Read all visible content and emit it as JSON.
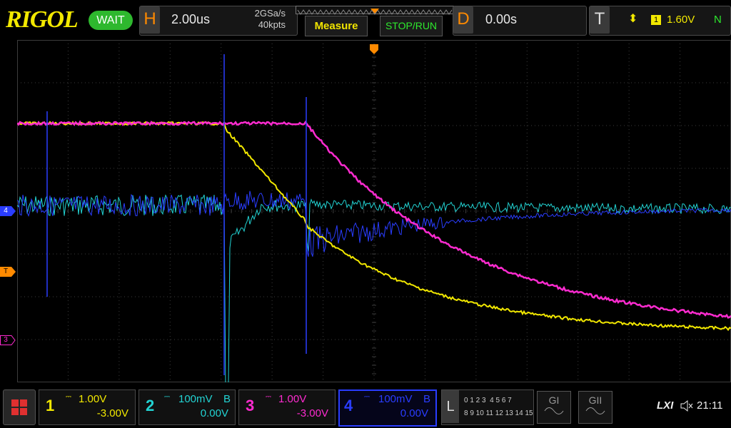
{
  "brand": "RIGOL",
  "run_state": "WAIT",
  "horizontal": {
    "tag": "H",
    "timebase": "2.00us",
    "sample_rate": "2GSa/s",
    "memory_depth": "40kpts"
  },
  "buttons": {
    "measure": "Measure",
    "stop_run": "STOP/RUN"
  },
  "delay": {
    "tag": "D",
    "value": "0.00s"
  },
  "trigger": {
    "tag": "T",
    "slope_symbol": "⬍",
    "source": "1",
    "level": "1.60V",
    "mode": "N"
  },
  "side_markers": {
    "channel4": "4",
    "trigger": "T",
    "channel3": "3"
  },
  "channels": [
    {
      "number": "1",
      "scale": "1.00V",
      "offset": "-3.00V",
      "coupling": "",
      "color": "#f2e800"
    },
    {
      "number": "2",
      "scale": "100mV",
      "offset": "0.00V",
      "coupling": "B",
      "color": "#22d3d3"
    },
    {
      "number": "3",
      "scale": "1.00V",
      "offset": "-3.00V",
      "coupling": "",
      "color": "#ff2bd0"
    },
    {
      "number": "4",
      "scale": "100mV",
      "offset": "0.00V",
      "coupling": "B",
      "color": "#2a3dff"
    }
  ],
  "logic": {
    "tag": "L",
    "row1": "0 1 2 3  4 5 6 7",
    "row2": "8 9 10 11 12 13 14 15"
  },
  "decode_buttons": [
    "GI",
    "GII"
  ],
  "status": {
    "lxi": "LXI",
    "time": "21:11"
  },
  "colors": {
    "grid": "#3c3c3c",
    "ch1": "#f2e800",
    "ch2": "#22d3d3",
    "ch3": "#ff2bd0",
    "ch4": "#2a3dff",
    "trigger": "#ff8a00"
  }
}
